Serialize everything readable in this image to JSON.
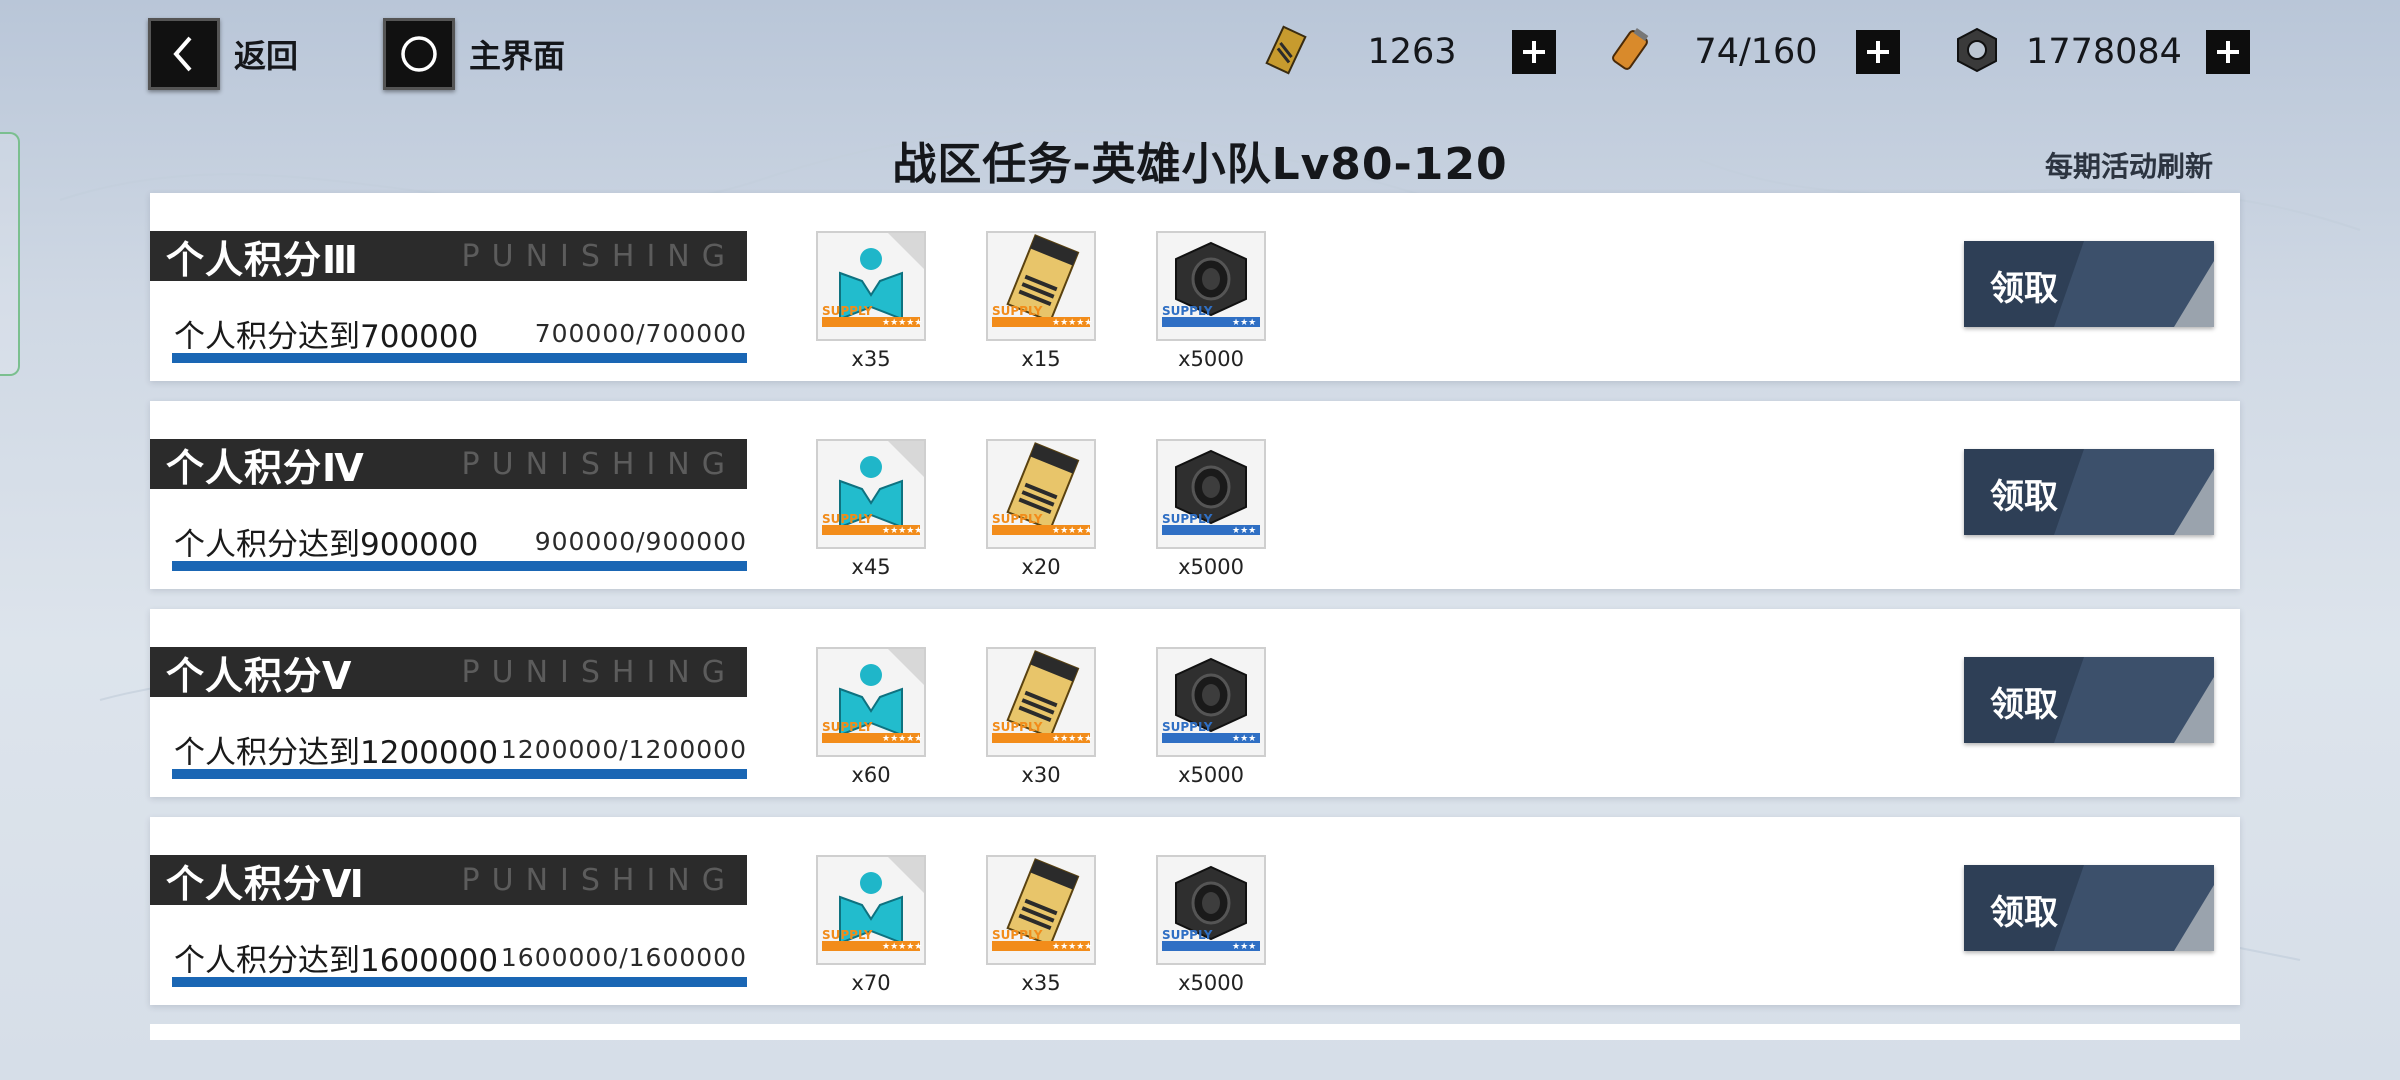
{
  "nav": {
    "back_label": "返回",
    "home_label": "主界面"
  },
  "resources": [
    {
      "icon": "gold-card-icon",
      "value": "1263"
    },
    {
      "icon": "fuel-cell-icon",
      "value": "74/160"
    },
    {
      "icon": "hex-nut-icon",
      "value": "1778084"
    }
  ],
  "page": {
    "title": "战区任务-英雄小队Lv80-120",
    "refresh_note": "每期活动刷新"
  },
  "tasks": [
    {
      "name": "个人积分Ⅲ",
      "watermark": "PUNISHING",
      "desc": "个人积分达到700000",
      "progress": "700000/700000",
      "progress_fraction": 1.0,
      "rewards": [
        {
          "icon": "character-shard-icon",
          "count": "x35"
        },
        {
          "icon": "gold-ticket-icon",
          "count": "x15"
        },
        {
          "icon": "hex-nut-icon",
          "count": "x5000"
        }
      ],
      "claim_label": "领取"
    },
    {
      "name": "个人积分Ⅳ",
      "watermark": "PUNISHING",
      "desc": "个人积分达到900000",
      "progress": "900000/900000",
      "progress_fraction": 1.0,
      "rewards": [
        {
          "icon": "character-shard-icon",
          "count": "x45"
        },
        {
          "icon": "gold-ticket-icon",
          "count": "x20"
        },
        {
          "icon": "hex-nut-icon",
          "count": "x5000"
        }
      ],
      "claim_label": "领取"
    },
    {
      "name": "个人积分Ⅴ",
      "watermark": "PUNISHING",
      "desc": "个人积分达到1200000",
      "progress": "1200000/1200000",
      "progress_fraction": 1.0,
      "rewards": [
        {
          "icon": "character-shard-icon",
          "count": "x60"
        },
        {
          "icon": "gold-ticket-icon",
          "count": "x30"
        },
        {
          "icon": "hex-nut-icon",
          "count": "x5000"
        }
      ],
      "claim_label": "领取"
    },
    {
      "name": "个人积分Ⅵ",
      "watermark": "PUNISHING",
      "desc": "个人积分达到1600000",
      "progress": "1600000/1600000",
      "progress_fraction": 1.0,
      "rewards": [
        {
          "icon": "character-shard-icon",
          "count": "x70"
        },
        {
          "icon": "gold-ticket-icon",
          "count": "x35"
        },
        {
          "icon": "hex-nut-icon",
          "count": "x5000"
        }
      ],
      "claim_label": "领取"
    }
  ],
  "colors": {
    "progress_fill": "#1a66b4",
    "claim_button": "#2e3f56",
    "header_bar": "#2b2b2b"
  }
}
